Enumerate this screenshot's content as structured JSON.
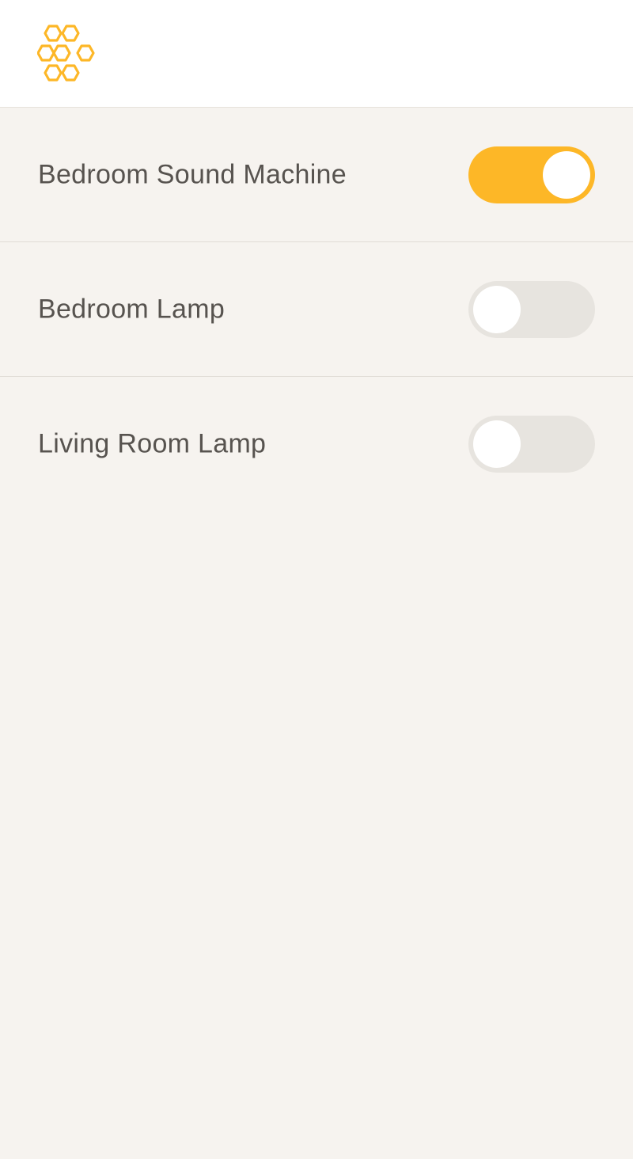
{
  "brand": {
    "logo_icon": "honeycomb-icon",
    "accent_color": "#fdb727"
  },
  "devices": [
    {
      "label": "Bedroom Sound Machine",
      "state": "on"
    },
    {
      "label": "Bedroom Lamp",
      "state": "off"
    },
    {
      "label": "Living Room Lamp",
      "state": "off"
    }
  ],
  "colors": {
    "background": "#f6f3ef",
    "header": "#ffffff",
    "toggle_on": "#fdb727",
    "toggle_off": "#e7e4df",
    "text": "#57534f"
  }
}
